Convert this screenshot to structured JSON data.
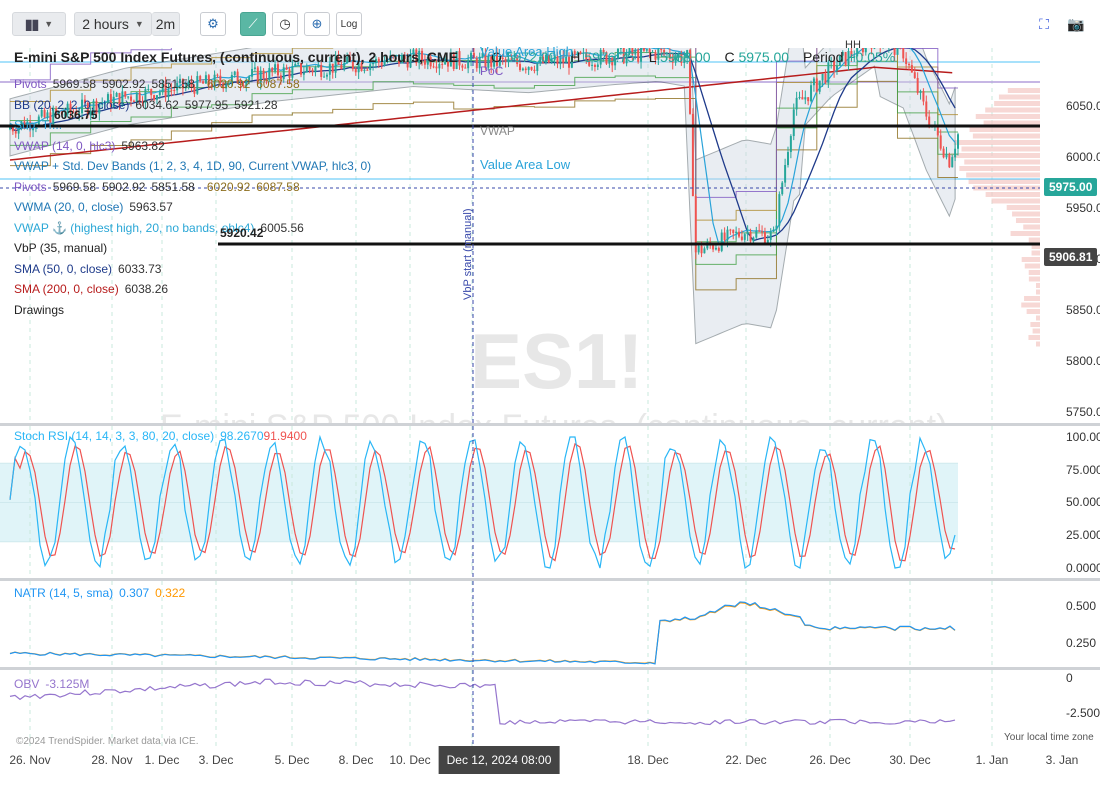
{
  "toolbar": {
    "interval_label": "2 hours",
    "interval_short": "2m",
    "log_label": "Log"
  },
  "chart": {
    "title": "E-mini S&P 500 Index Futures, (continuous, current), 2 hours, CME",
    "ohlc": {
      "o_label": "O",
      "o": "5972.00",
      "h_label": "H",
      "h": "5976.75",
      "l_label": "L",
      "l": "5968.00",
      "c_label": "C",
      "c": "5975.00",
      "period_label": "Period",
      "period": "+0.05%"
    },
    "watermark_symbol": "ES1!",
    "watermark_name": "E-mini S&P 500 Index Futures, (continuous, current)",
    "price_badge": "5975.00",
    "cursor_badge": "5906.81",
    "annotations": {
      "value_area_high": "Value Area High",
      "value_area_low": "Value Area Low",
      "poc": "PoC",
      "vwap": "VWAP",
      "hh": "HH",
      "vbp_start": "VbP start (manual)",
      "level_high": "6036.75",
      "level_low": "5920.42"
    },
    "legend": [
      {
        "name": "Pivots",
        "values": [
          "5969.58",
          "5902.92",
          "5851.58",
          "",
          "6020.92",
          "6087.58",
          ""
        ],
        "color": "#7e57c2"
      },
      {
        "name": "BB (20, 2, 2, 0, close)",
        "values": [
          "6034.62",
          "5977.95",
          "5921.28"
        ],
        "color": "#1e3a8a"
      },
      {
        "name": "Sup. Tr...",
        "values": [],
        "color": "#29a3d9"
      },
      {
        "name": "VWAP (14, 0, hlc3)",
        "values": [
          "5963.82"
        ],
        "color": "#7e57c2"
      },
      {
        "name": "VWAP + Std. Dev Bands (1, 2, 3, 4, 1D, 90, Current VWAP, hlc3, 0)",
        "values": [],
        "color": "#1f77b4"
      },
      {
        "name": "Pivots",
        "values": [
          "5969.58",
          "5902.92",
          "5851.58",
          "",
          "6020.92",
          "6087.58",
          ""
        ],
        "color": "#7e57c2"
      },
      {
        "name": "VWMA (20, 0, close)",
        "values": [
          "5963.57"
        ],
        "color": "#1f77b4"
      },
      {
        "name": "VWAP ⚓ (highest high, 20, no bands, ohlc4)",
        "values": [
          "6005.56"
        ],
        "color": "#2aa7d6"
      },
      {
        "name": "VbP (35, manual)",
        "values": [],
        "color": "#222"
      },
      {
        "name": "SMA (50, 0, close)",
        "values": [
          "6033.73"
        ],
        "color": "#1e3a8a"
      },
      {
        "name": "SMA (200, 0, close)",
        "values": [
          "6038.26"
        ],
        "color": "#b71c1c"
      },
      {
        "name": "Drawings",
        "values": [],
        "color": "#222"
      }
    ],
    "price_ticks": [
      "6050.00",
      "6000.00",
      "5950.00",
      "5900.00",
      "5850.00",
      "5800.00",
      "5750.00"
    ]
  },
  "stoch": {
    "label": "Stoch RSI (14, 14, 3, 3, 80, 20, close)",
    "k": "98.2670",
    "d": "91.9400",
    "ticks": [
      "100.0000",
      "75.0000",
      "50.0000",
      "25.0000",
      "0.0000"
    ]
  },
  "natr": {
    "label": "NATR (14, 5, sma)",
    "v1": "0.307",
    "v2": "0.322",
    "ticks": [
      "0.500",
      "0.250"
    ]
  },
  "obv": {
    "label": "OBV",
    "value": "-3.125M",
    "ticks": [
      "0",
      "-2.500M"
    ]
  },
  "footer": {
    "copyright": "©2024 TrendSpider. Market data via ICE.",
    "timezone": "Your local time zone"
  },
  "xaxis": {
    "ticks": [
      "26. Nov",
      "28. Nov",
      "1. Dec",
      "3. Dec",
      "5. Dec",
      "8. Dec",
      "10. Dec",
      "12. Dec",
      "18. Dec",
      "22. Dec",
      "26. Dec",
      "30. Dec",
      "1. Jan",
      "3. Jan"
    ],
    "cursor_label": "Dec 12, 2024 08:00"
  },
  "colors": {
    "accent": "#26a69a",
    "up": "#26a69a",
    "down": "#ef5350",
    "rsi_k": "#29b6f6",
    "rsi_d": "#ef5350",
    "natr1": "#2196f3",
    "natr2": "#ff9800",
    "obv": "#9575cd"
  }
}
